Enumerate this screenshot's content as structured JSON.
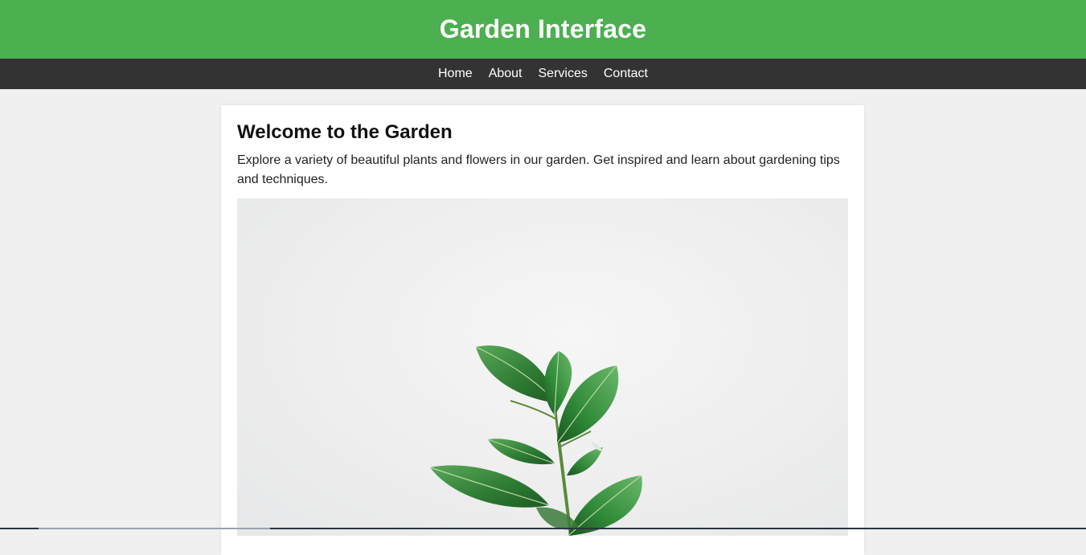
{
  "header": {
    "title": "Garden Interface"
  },
  "nav": {
    "items": [
      {
        "label": "Home"
      },
      {
        "label": "About"
      },
      {
        "label": "Services"
      },
      {
        "label": "Contact"
      }
    ]
  },
  "main": {
    "heading": "Welcome to the Garden",
    "text": "Explore a variety of beautiful plants and flowers in our garden. Get inspired and learn about gardening tips and techniques."
  },
  "colors": {
    "header_bg": "#4caf50",
    "nav_bg": "#333333",
    "page_bg": "#f0f0f0",
    "card_bg": "#ffffff",
    "leaf": "#2e7d32"
  }
}
